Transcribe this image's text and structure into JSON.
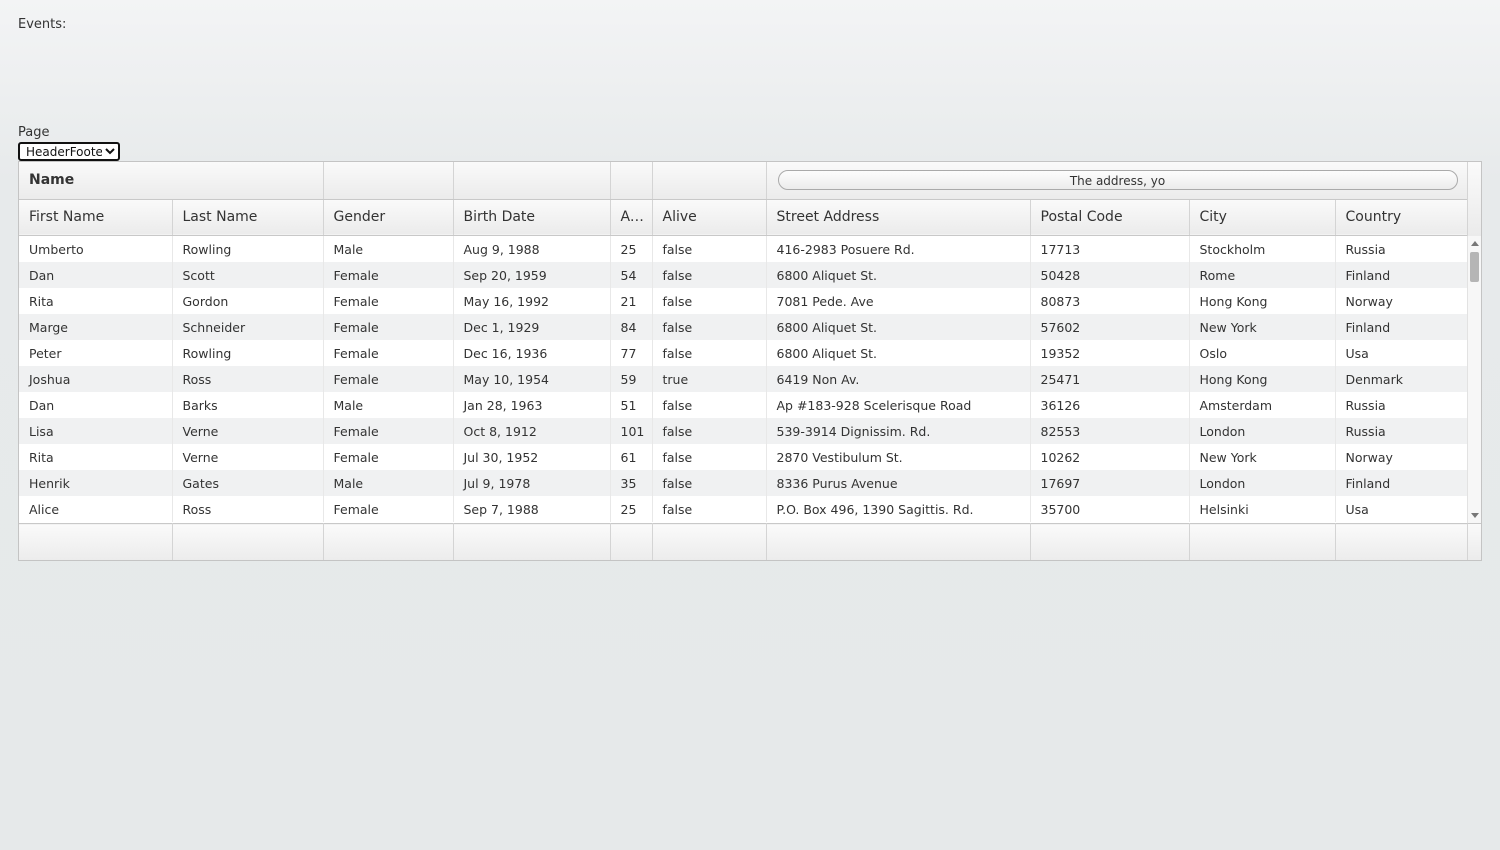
{
  "events": {
    "label": "Events:"
  },
  "page_select": {
    "label": "Page",
    "selected": "HeaderFooter"
  },
  "grid": {
    "group_header": {
      "name_label": "Name",
      "address_button": "The address, yo"
    },
    "columns": [
      "First Name",
      "Last Name",
      "Gender",
      "Birth Date",
      "A...",
      "Alive",
      "Street Address",
      "Postal Code",
      "City",
      "Country"
    ],
    "rows": [
      [
        "Umberto",
        "Rowling",
        "Male",
        "Aug 9, 1988",
        "25",
        "false",
        "416-2983 Posuere Rd.",
        "17713",
        "Stockholm",
        "Russia"
      ],
      [
        "Dan",
        "Scott",
        "Female",
        "Sep 20, 1959",
        "54",
        "false",
        "6800 Aliquet St.",
        "50428",
        "Rome",
        "Finland"
      ],
      [
        "Rita",
        "Gordon",
        "Female",
        "May 16, 1992",
        "21",
        "false",
        "7081 Pede. Ave",
        "80873",
        "Hong Kong",
        "Norway"
      ],
      [
        "Marge",
        "Schneider",
        "Female",
        "Dec 1, 1929",
        "84",
        "false",
        "6800 Aliquet St.",
        "57602",
        "New York",
        "Finland"
      ],
      [
        "Peter",
        "Rowling",
        "Female",
        "Dec 16, 1936",
        "77",
        "false",
        "6800 Aliquet St.",
        "19352",
        "Oslo",
        "Usa"
      ],
      [
        "Joshua",
        "Ross",
        "Female",
        "May 10, 1954",
        "59",
        "true",
        "6419 Non Av.",
        "25471",
        "Hong Kong",
        "Denmark"
      ],
      [
        "Dan",
        "Barks",
        "Male",
        "Jan 28, 1963",
        "51",
        "false",
        "Ap #183-928 Scelerisque Road",
        "36126",
        "Amsterdam",
        "Russia"
      ],
      [
        "Lisa",
        "Verne",
        "Female",
        "Oct 8, 1912",
        "101",
        "false",
        "539-3914 Dignissim. Rd.",
        "82553",
        "London",
        "Russia"
      ],
      [
        "Rita",
        "Verne",
        "Female",
        "Jul 30, 1952",
        "61",
        "false",
        "2870 Vestibulum St.",
        "10262",
        "New York",
        "Norway"
      ],
      [
        "Henrik",
        "Gates",
        "Male",
        "Jul 9, 1978",
        "35",
        "false",
        "8336 Purus Avenue",
        "17697",
        "London",
        "Finland"
      ],
      [
        "Alice",
        "Ross",
        "Female",
        "Sep 7, 1988",
        "25",
        "false",
        "P.O. Box 496, 1390 Sagittis. Rd.",
        "35700",
        "Helsinki",
        "Usa"
      ]
    ]
  }
}
